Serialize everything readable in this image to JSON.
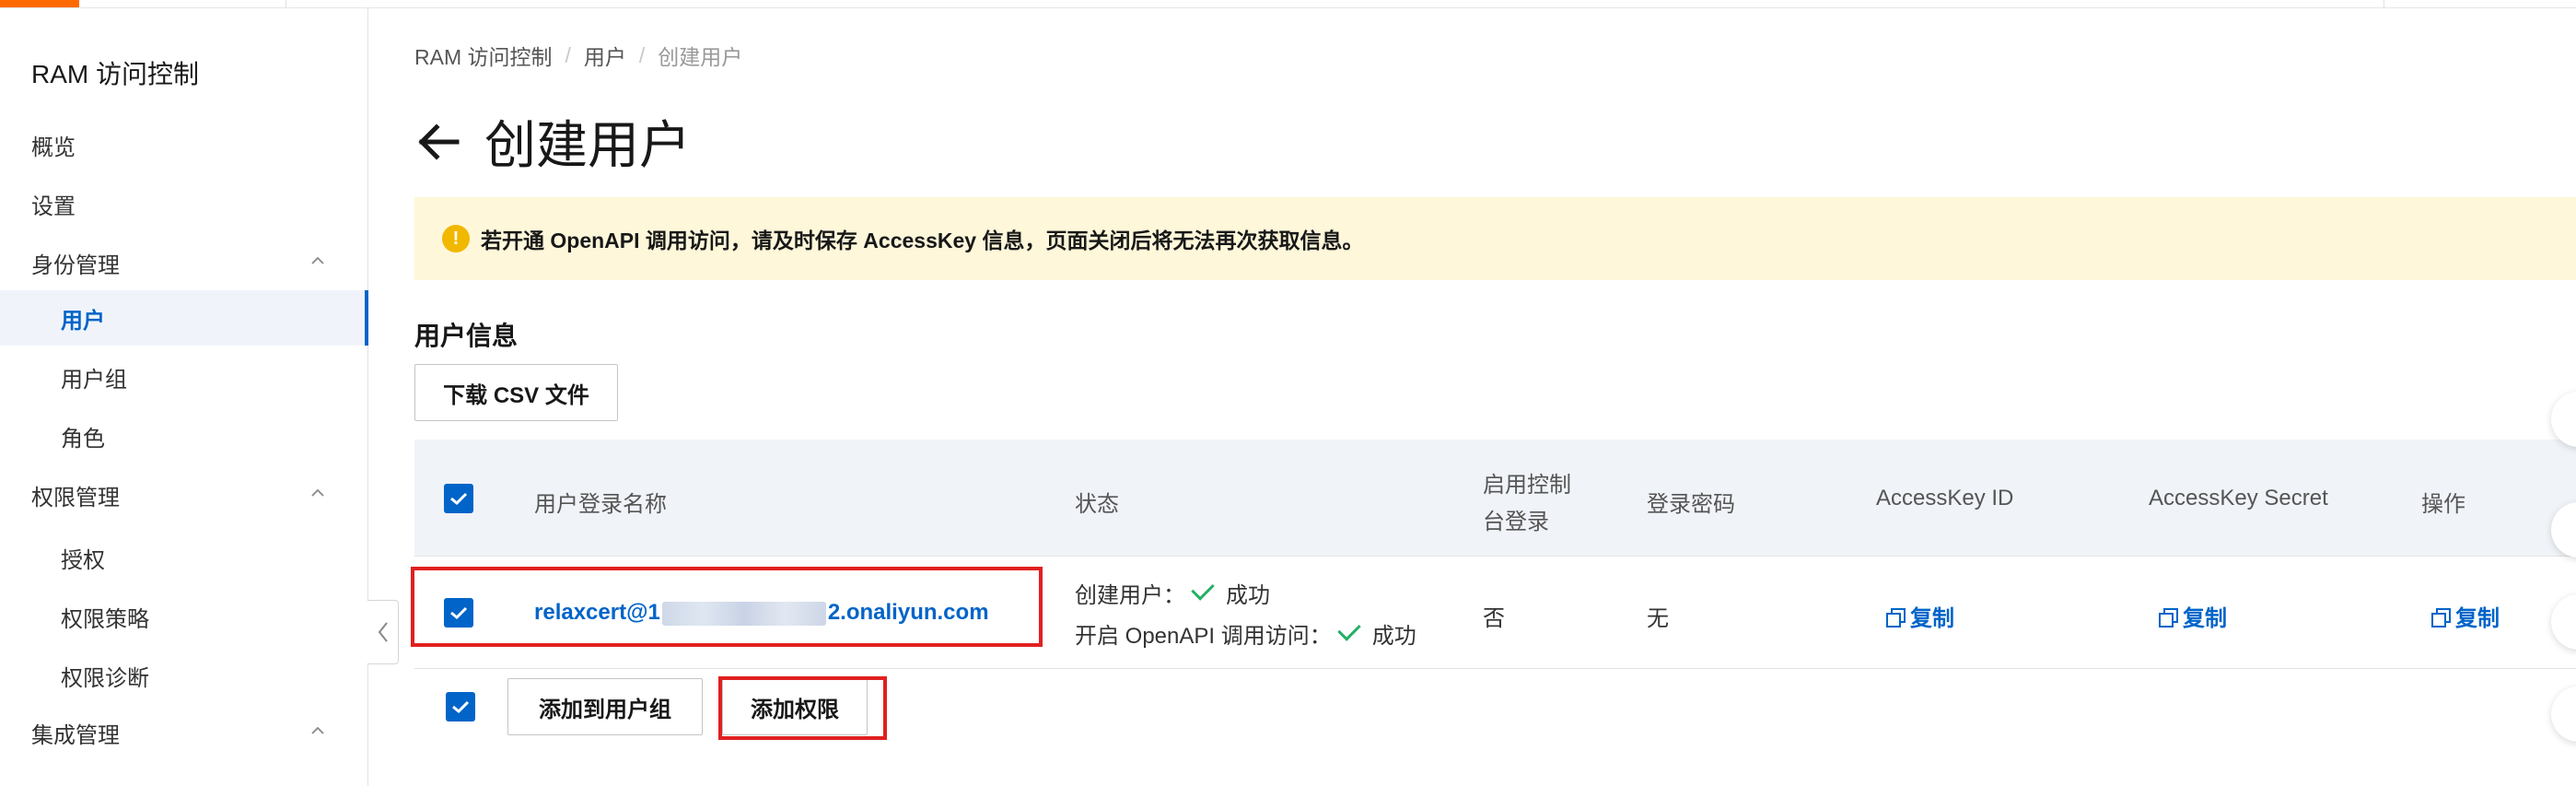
{
  "sidebar": {
    "title": "RAM 访问控制",
    "items": [
      {
        "label": "概览",
        "level": 1
      },
      {
        "label": "设置",
        "level": 1
      },
      {
        "label": "身份管理",
        "level": 1,
        "expanded": true
      },
      {
        "label": "用户",
        "level": 2,
        "active": true
      },
      {
        "label": "用户组",
        "level": 2
      },
      {
        "label": "角色",
        "level": 2
      },
      {
        "label": "权限管理",
        "level": 1,
        "expanded": true
      },
      {
        "label": "授权",
        "level": 2
      },
      {
        "label": "权限策略",
        "level": 2
      },
      {
        "label": "权限诊断",
        "level": 2
      },
      {
        "label": "集成管理",
        "level": 1,
        "expanded": true
      }
    ]
  },
  "breadcrumb": [
    "RAM 访问控制",
    "用户",
    "创建用户"
  ],
  "page": {
    "title": "创建用户"
  },
  "alert": {
    "text": "若开通 OpenAPI 调用访问，请及时保存 AccessKey 信息，页面关闭后将无法再次获取信息。"
  },
  "section": {
    "title": "用户信息",
    "download_button": "下载 CSV 文件"
  },
  "table": {
    "headers": {
      "login_name": "用户登录名称",
      "status": "状态",
      "console_login_line1": "启用控制",
      "console_login_line2": "台登录",
      "password": "登录密码",
      "access_key_id": "AccessKey ID",
      "access_key_secret": "AccessKey Secret",
      "actions": "操作"
    },
    "row": {
      "login_name_prefix": "relaxcert@1",
      "login_name_suffix": "2.onaliyun.com",
      "status_create_label": "创建用户：",
      "status_create_value": "成功",
      "status_openapi_label": "开启 OpenAPI 调用访问：",
      "status_openapi_value": "成功",
      "console_login": "否",
      "password": "无",
      "copy_id": "复制",
      "copy_secret": "复制",
      "copy_action": "复制"
    }
  },
  "actions": {
    "add_to_group": "添加到用户组",
    "add_permission": "添加权限"
  },
  "colors": {
    "accent": "#0064c8",
    "alert_bg": "#fef7da",
    "highlight": "#e02020",
    "success": "#23b066"
  }
}
